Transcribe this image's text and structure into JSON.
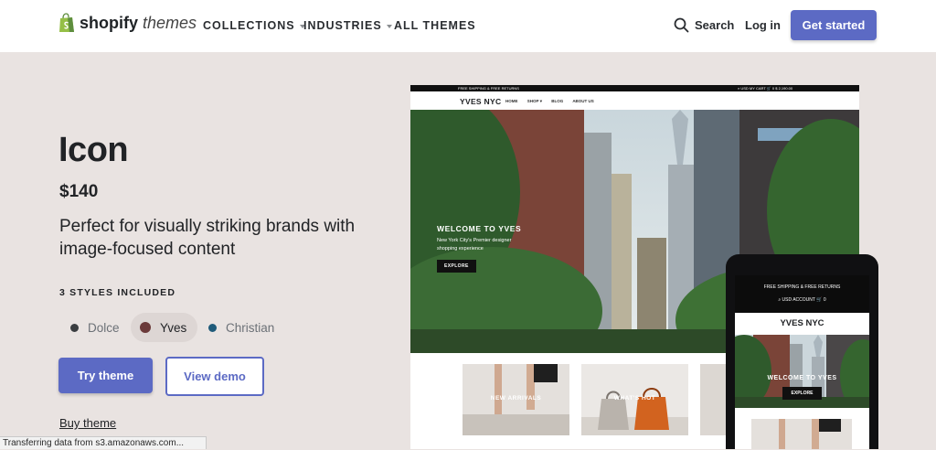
{
  "header": {
    "logo_brand": "shopify",
    "logo_suffix": "themes",
    "nav": [
      {
        "label": "COLLECTIONS",
        "has_caret": true
      },
      {
        "label": "INDUSTRIES",
        "has_caret": true
      },
      {
        "label": "ALL THEMES",
        "has_caret": false
      }
    ],
    "search_label": "Search",
    "search_icon": "search-icon",
    "login_label": "Log in",
    "cta_label": "Get started"
  },
  "theme": {
    "name": "Icon",
    "price": "$140",
    "tagline": "Perfect for visually striking brands with image-focused content",
    "styles_heading": "3 STYLES INCLUDED",
    "styles": [
      {
        "label": "Dolce",
        "color": "#3a3d40",
        "selected": false
      },
      {
        "label": "Yves",
        "color": "#6b3a3a",
        "selected": true
      },
      {
        "label": "Christian",
        "color": "#1f5b7a",
        "selected": false
      }
    ],
    "try_label": "Try theme",
    "demo_label": "View demo",
    "buy_label": "Buy theme"
  },
  "preview_desktop": {
    "announcement": "FREE SHIPPING & FREE RETURNS",
    "utility": "⌕  USD    MY CART  🛒 0  $ 2,190.00",
    "brand": "YVES NYC",
    "nav": [
      "HOME",
      "SHOP ▾",
      "BLOG",
      "ABOUT US"
    ],
    "hero_title": "WELCOME TO YVES",
    "hero_subtitle": "New York City's Premier designer shopping experience",
    "hero_button": "EXPLORE",
    "tiles": [
      {
        "label": "NEW ARRIVALS"
      },
      {
        "label": "WHAT'S HOT"
      },
      {
        "label": ""
      }
    ]
  },
  "preview_mobile": {
    "announcement": "FREE SHIPPING & FREE RETURNS",
    "utility": "⌕  USD ACCOUNT  🛒 0",
    "brand": "YVES NYC",
    "hero_title": "WELCOME TO YVES",
    "hero_button": "EXPLORE"
  },
  "status_bar": {
    "text": "Transferring data from s3.amazonaws.com..."
  },
  "colors": {
    "accent": "#5c6ac4",
    "page_background": "#e9e3e1",
    "text": "#212326"
  }
}
